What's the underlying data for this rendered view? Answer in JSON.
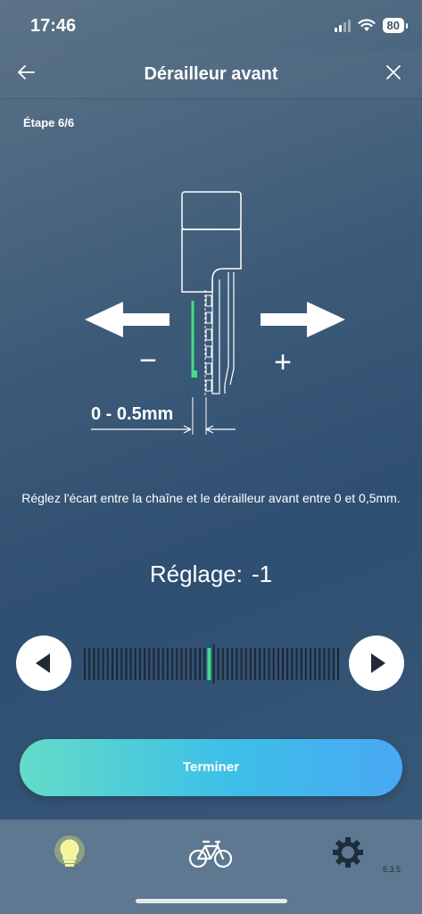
{
  "status_bar": {
    "time": "17:46",
    "battery": "80"
  },
  "nav": {
    "back_icon": "arrow-left-icon",
    "title": "Dérailleur avant",
    "close_icon": "close-icon"
  },
  "step": "Étape 6/6",
  "diagram": {
    "gap_label": "0 - 0.5mm",
    "minus_label": "−",
    "plus_label": "+"
  },
  "instruction": "Réglez l'écart entre la chaîne et le dérailleur avant entre 0 et 0,5mm.",
  "setting": {
    "label": "Réglage:",
    "value": "-1"
  },
  "slider": {
    "left_icon": "triangle-left-icon",
    "right_icon": "triangle-right-icon",
    "tick_count": 56,
    "center_index": 28,
    "selected_index": 27,
    "tick_color": "#1c2733",
    "active_color": "#3ee08a"
  },
  "finish_button": "Terminer",
  "tabs": [
    {
      "name": "tips",
      "icon": "lightbulb-icon",
      "active": true
    },
    {
      "name": "bike",
      "icon": "bicycle-icon",
      "active": false
    },
    {
      "name": "settings",
      "icon": "gear-icon",
      "active": false
    }
  ],
  "version": "5.3.5",
  "colors": {
    "accent_green": "#3ee08a",
    "button_gradient_start": "#63dcc8",
    "button_gradient_end": "#49a8f4"
  }
}
